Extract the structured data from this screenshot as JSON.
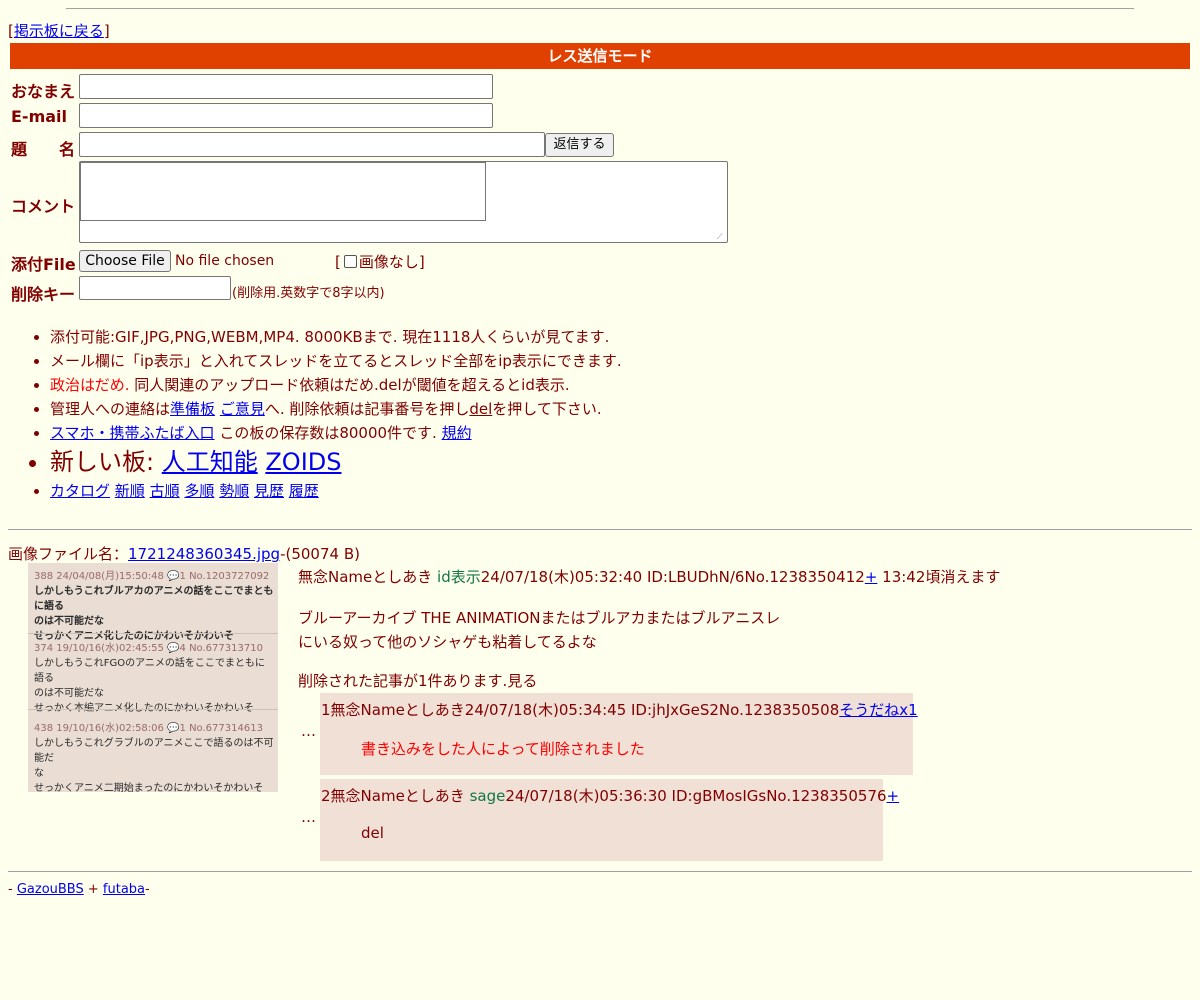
{
  "back_link": {
    "prefix": "[",
    "label": "掲示板に戻る",
    "suffix": "]"
  },
  "mode_title": "レス送信モード",
  "form": {
    "name_label": "おなまえ",
    "email_label": "E-mail",
    "subject_label": "題　　名",
    "submit_label": "返信する",
    "comment_label": "コメント",
    "file_label": "添付File",
    "choose_file_label": "Choose File",
    "no_file_text": "No file chosen",
    "no_image_prefix": "[",
    "no_image_label": "画像なし",
    "no_image_suffix": "]",
    "delkey_label": "削除キー",
    "delkey_hint": "(削除用.英数字で8字以内)"
  },
  "notes": {
    "line1": "添付可能:GIF,JPG,PNG,WEBM,MP4. 8000KBまで. 現在1118人くらいが見てます.",
    "line2": "メール欄に「ip表示」と入れてスレッドを立てるとスレッド全部をip表示にできます.",
    "line3_red": "政治はだめ.",
    "line3_rest": " 同人関連のアップロード依頼はだめ.delが閾値を超えるとid表示.",
    "line4_a": "管理人への連絡は",
    "line4_link1": "準備板",
    "line4_link2": "ご意見",
    "line4_b": "へ. 削除依頼は記事番号を押し",
    "line4_del": "del",
    "line4_c": "を押して下さい.",
    "line5_link": "スマホ・携帯ふたば入口",
    "line5_text": " この板の保存数は80000件です. ",
    "line5_rule": "規約",
    "line6_prefix": "新しい板: ",
    "line6_link1": "人工知能",
    "line6_link2": "ZOIDS",
    "sort_links": [
      "カタログ",
      "新順",
      "古順",
      "多順",
      "勢順",
      "見歴",
      "履歴"
    ]
  },
  "file_info": {
    "prefix": "画像ファイル名：",
    "filename": "1721248360345.jpg",
    "suffix": "-(50074 B)"
  },
  "thumbnail": {
    "entries": [
      {
        "meta": "388 24/04/08(月)15:50:48 💬1 No.1203727092",
        "line1": "しかしもうこれブルアカのアニメの話をここでまともに語る",
        "line2": "のは不可能だな",
        "line3": "せっかくアニメ化したのにかわいそかわいそ"
      },
      {
        "meta": "374 19/10/16(水)02:45:55 💬4 No.677313710",
        "line1": "しかしもうこれFGOのアニメの話をここでまともに語る",
        "line2": "のは不可能だな",
        "line3": "せっかく本編アニメ化したのにかわいそかわいそ"
      },
      {
        "meta": "438 19/10/16(水)02:58:06 💬1 No.677314613",
        "line1": "しかしもうこれグラブルのアニメここで語るのは不可能だ",
        "line2": "な",
        "line3": "せっかくアニメ二期始まったのにかわいそかわいそ"
      }
    ]
  },
  "post": {
    "name": "無念Nameとしあき ",
    "id_tag": "id表示",
    "date": "24/07/18(木)05:32:40 ID:LBUDhN/6No.1238350412",
    "plus": "+",
    "expire": " 13:42頃消えます",
    "body_line1": "ブルーアーカイブ THE ANIMATIONまたはブルアカまたはブルアニスレ",
    "body_line2": "にいる奴って他のソシャゲも粘着してるよな",
    "deleted_note": "削除された記事が1件あります.見る"
  },
  "replies": [
    {
      "dots": "…",
      "num": "1",
      "head": "無念Nameとしあき24/07/18(木)05:34:45 ID:jhJxGeS2No.1238350508",
      "link": "そうだねx1",
      "body": "書き込みをした人によって削除されました"
    },
    {
      "dots": "…",
      "num": "2",
      "head_name": "無念Nameとしあき ",
      "sage": "sage",
      "head_rest": "24/07/18(木)05:36:30 ID:gBMosIGsNo.1238350576",
      "link": "+",
      "body": "del"
    }
  ],
  "footer": {
    "dash1": "- ",
    "link1": "GazouBBS",
    "plus": " + ",
    "link2": "futaba",
    "dash2": "-"
  }
}
